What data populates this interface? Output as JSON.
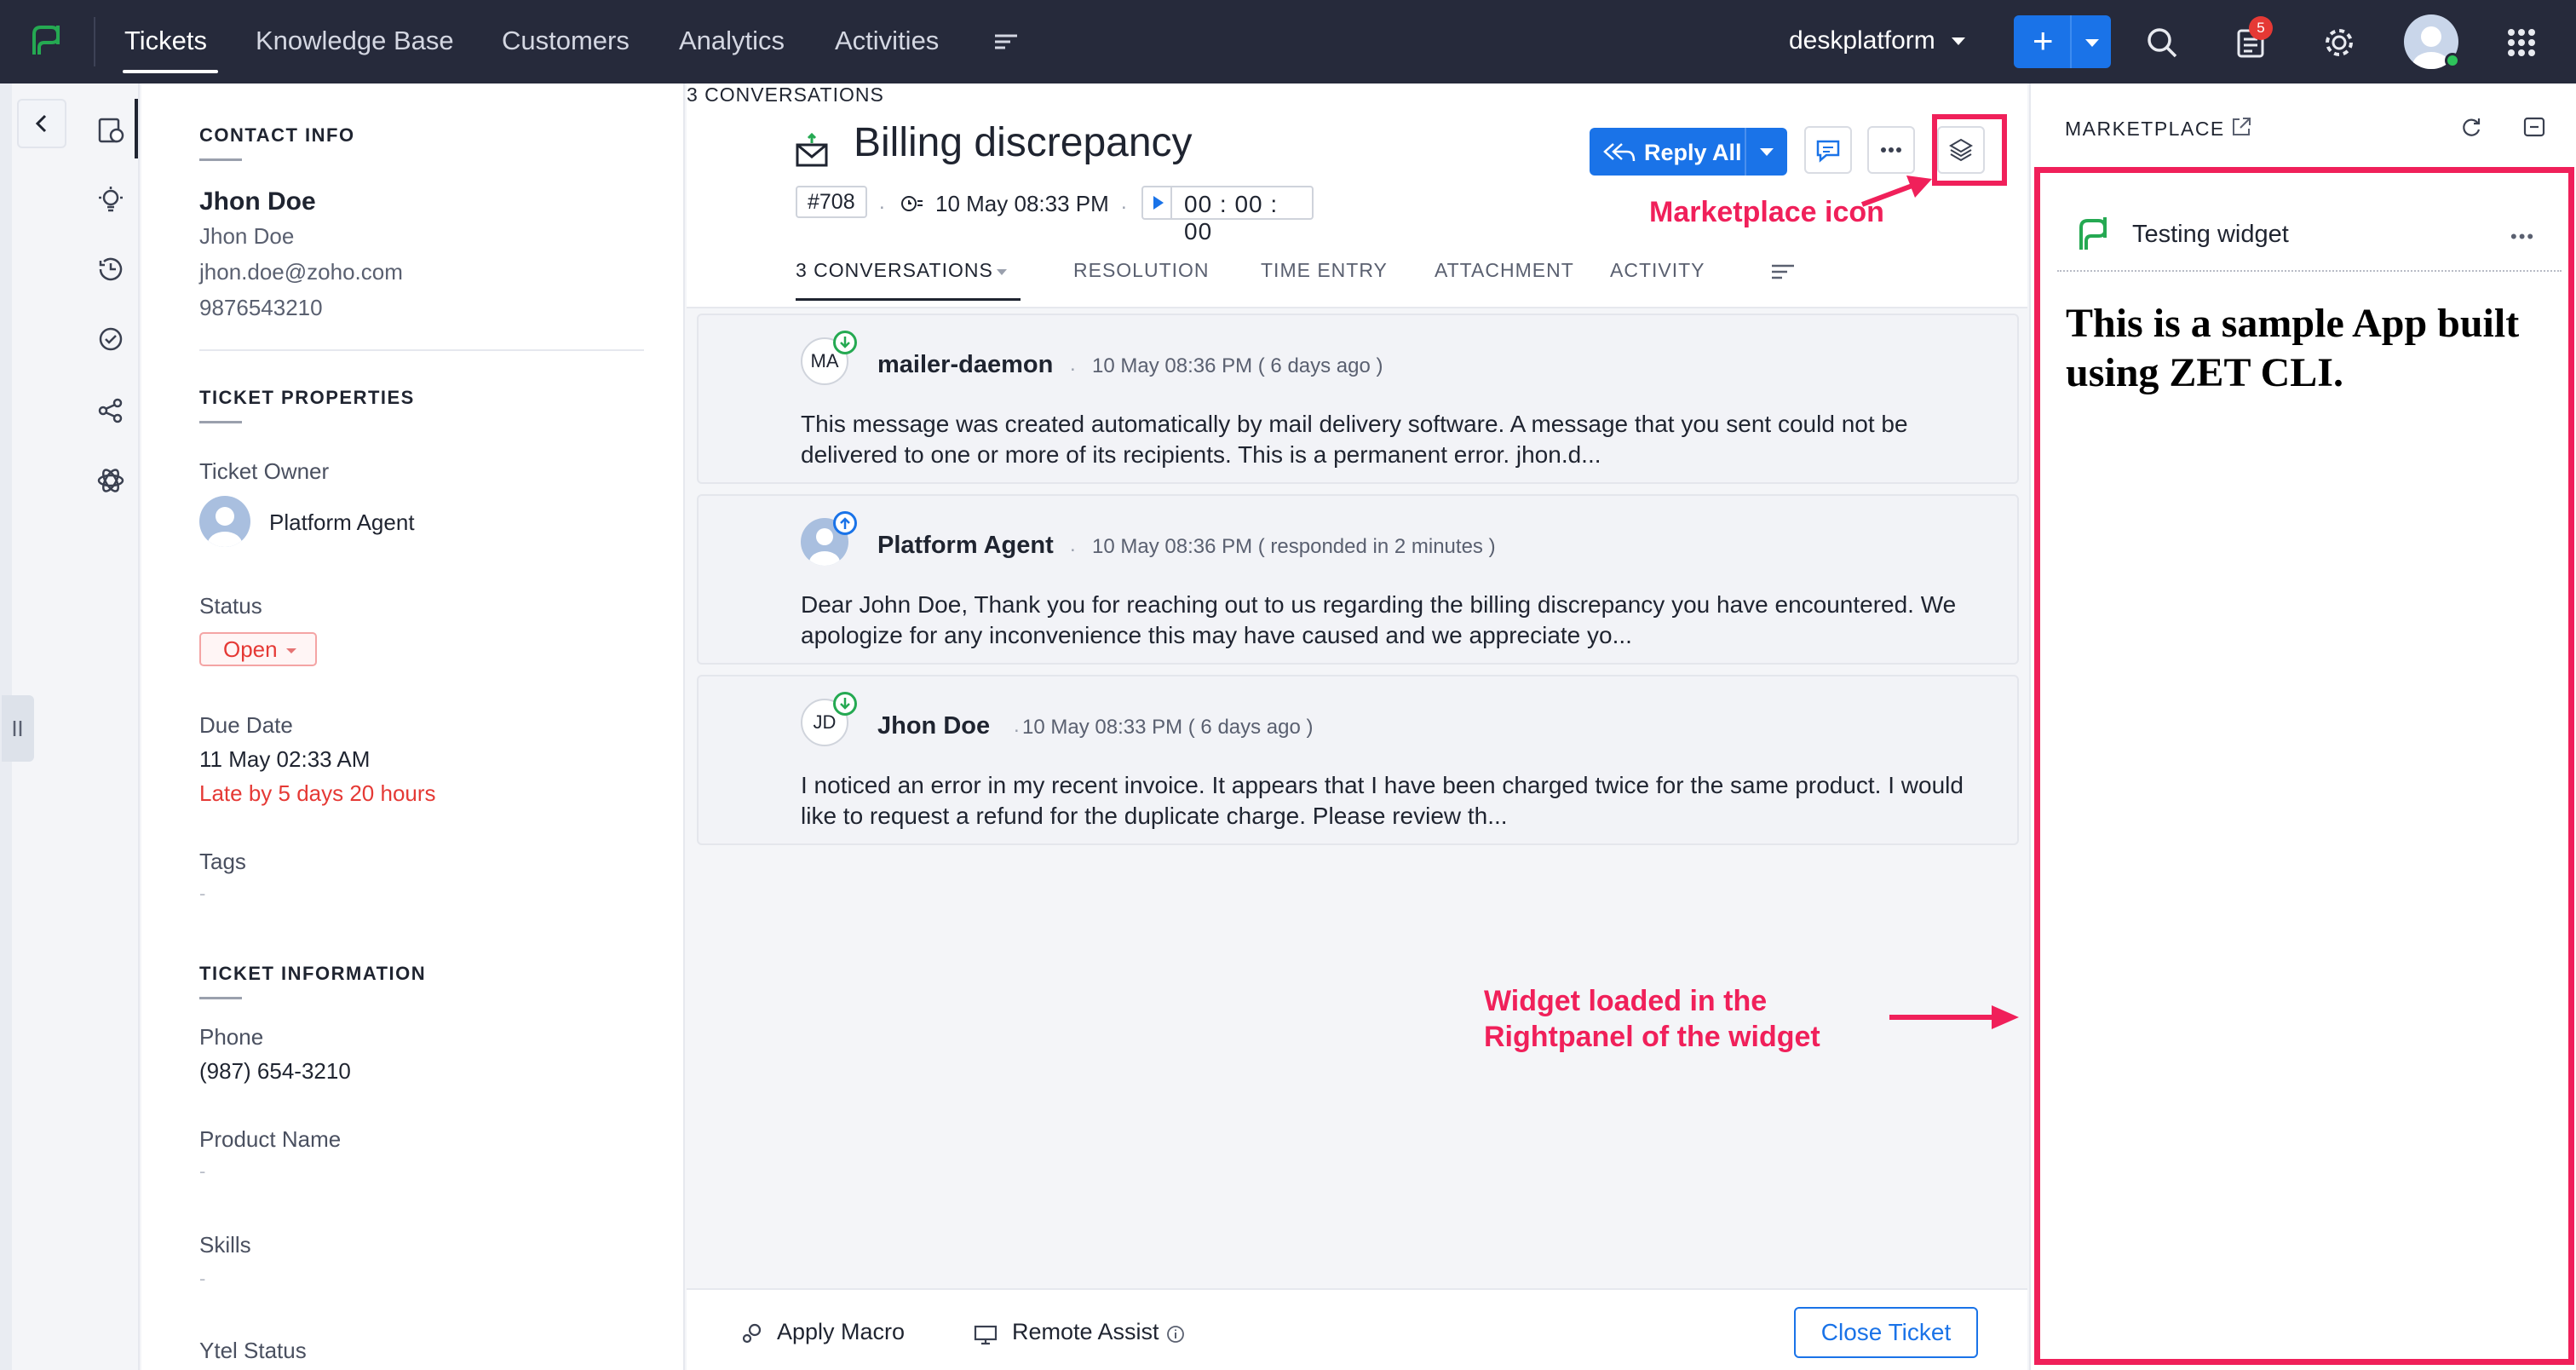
{
  "topbar": {
    "nav": [
      "Tickets",
      "Knowledge Base",
      "Customers",
      "Analytics",
      "Activities"
    ],
    "org": "deskplatform",
    "notification_count": "5",
    "icons": [
      "app-logo-icon",
      "more-menu-icon",
      "plus-icon",
      "search-icon",
      "notifications-icon",
      "settings-icon",
      "avatar",
      "app-grid-icon"
    ]
  },
  "left_icons": [
    "ticket-properties-icon",
    "ideas-icon",
    "history-icon",
    "checklist-icon",
    "share-icon",
    "integrations-icon"
  ],
  "properties": {
    "contact_head": "CONTACT INFO",
    "contact_name": "Jhon Doe",
    "contact_sub": "Jhon Doe",
    "contact_email": "jhon.doe@zoho.com",
    "contact_phone": "9876543210",
    "ticket_props_head": "TICKET PROPERTIES",
    "owner_label": "Ticket Owner",
    "owner_name": "Platform Agent",
    "status_label": "Status",
    "status_value": "Open",
    "due_label": "Due Date",
    "due_value": "11 May 02:33 AM",
    "due_late": "Late by 5 days 20 hours",
    "tags_label": "Tags",
    "tags_value": "-",
    "info_head": "TICKET INFORMATION",
    "phone_label": "Phone",
    "phone_value": "(987) 654-3210",
    "product_label": "Product Name",
    "product_value": "-",
    "skills_label": "Skills",
    "skills_value": "-",
    "ytel_label": "Ytel Status"
  },
  "ticket": {
    "title": "Billing discrepancy",
    "id": "#708",
    "date": "10 May 08:33 PM",
    "timer": "00 : 00 : 00",
    "reply_all": "Reply All",
    "tabs": [
      "3 CONVERSATIONS",
      "RESOLUTION",
      "TIME ENTRY",
      "ATTACHMENT",
      "ACTIVITY"
    ]
  },
  "conversations": [
    {
      "initials": "MA",
      "name": "mailer-daemon",
      "meta": "10 May 08:36 PM ( 6 days ago )",
      "body": "This message was created automatically by mail delivery software. A message that you sent could not be delivered to one or more of its recipients. This is a permanent error. jhon.d..."
    },
    {
      "initials": "",
      "name": "Platform Agent",
      "meta": "10 May 08:36 PM ( responded in 2 minutes )",
      "body": "Dear John Doe, Thank you for reaching out to us regarding the billing discrepancy you have encountered. We apologize for any inconvenience this may have caused and we appreciate yo..."
    },
    {
      "initials": "JD",
      "name": "Jhon Doe",
      "meta": "10 May 08:33 PM ( 6 days ago )",
      "body": "I noticed an error in my recent invoice. It appears that I have been charged twice for the same product. I would like to request a refund for the duplicate charge. Please review th..."
    }
  ],
  "footer": {
    "apply_macro": "Apply Macro",
    "remote_assist": "Remote Assist",
    "close_ticket": "Close Ticket"
  },
  "annotations": {
    "marketplace_icon": "Marketplace icon",
    "widget_line1": "Widget loaded in the",
    "widget_line2": "Rightpanel of the widget"
  },
  "right_panel": {
    "title": "MARKETPLACE",
    "widget_name": "Testing widget",
    "widget_content": "This is a sample App built using ZET CLI."
  },
  "colors": {
    "topbar": "#262a3b",
    "accent": "#1a73e8",
    "annotation": "#f0205a",
    "status_open": "#e53935",
    "brand_green": "#25a952"
  }
}
